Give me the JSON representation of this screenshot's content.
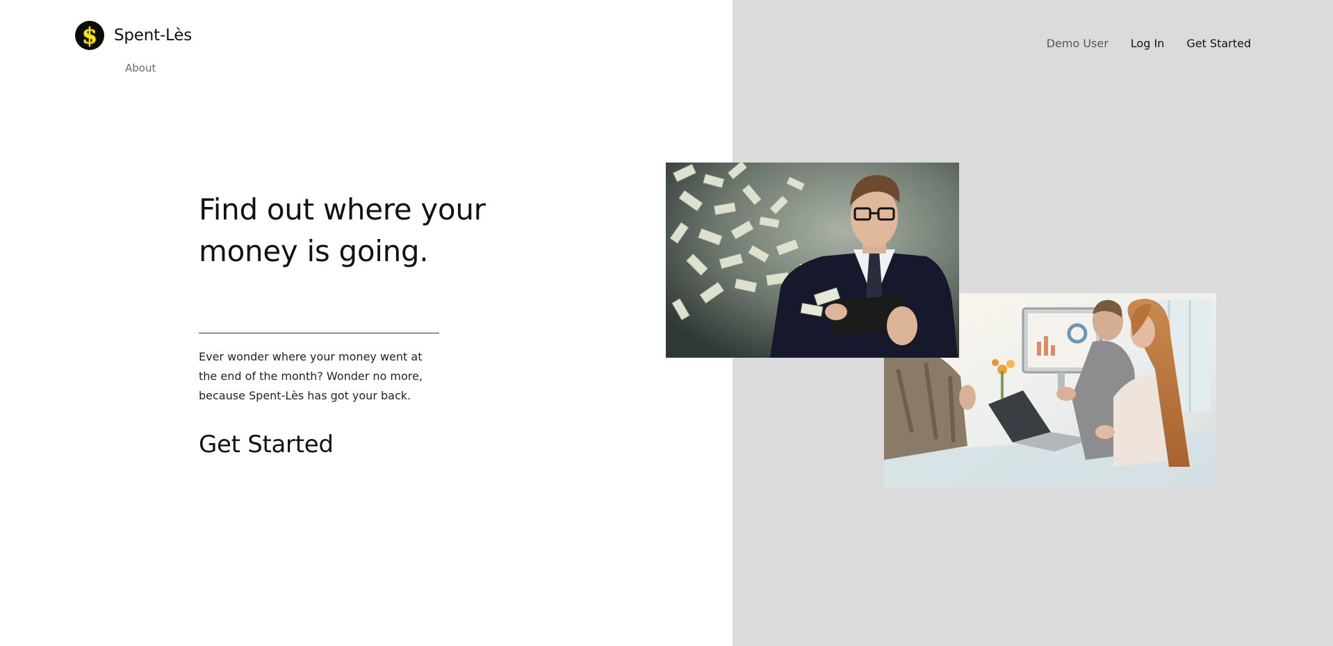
{
  "header": {
    "brand_name": "Spent-Lès",
    "logo_glyph": "$",
    "about_label": "About",
    "nav": {
      "demo_label": "Demo User",
      "login_label": "Log In",
      "get_started_label": "Get Started"
    }
  },
  "hero": {
    "title": "Find out where your money is going.",
    "description": "Ever wonder where your money went at the end of the month? Wonder no more, because Spent-Lès has got your back.",
    "cta_label": "Get Started"
  },
  "images": [
    {
      "subject": "man-with-wallet-and-flying-money"
    },
    {
      "subject": "team-meeting-at-glass-table"
    }
  ],
  "colors": {
    "right_panel_bg": "#dbdbdb",
    "logo_bg": "#0c0c0c",
    "logo_symbol": "#f5e71c"
  }
}
